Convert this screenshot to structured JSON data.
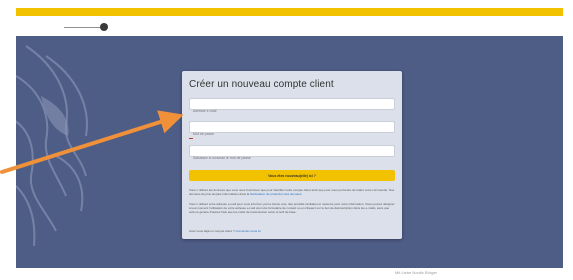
{
  "header": {
    "logo_icon": "logo-mark-icon"
  },
  "card": {
    "title": "Créer un nouveau compte client",
    "fields": [
      {
        "placeholder": "Adresse e-mail"
      },
      {
        "placeholder": "Mot de passe"
      },
      {
        "placeholder": "Saisissez à nouveau le mot de passe"
      }
    ],
    "submit_label": "Vous êtes nouveau(elle) ici ?",
    "paragraph1_text": "Vous n’utilisez les données que vous nous fournissez que pour identifier votre compte client ainsi que pour vous permettre de traiter votre commande. Nos données de plus amples informations dans la",
    "paragraph1_link": "Déclaration de protection des données.",
    "paragraph2_text": "Vous n’utilisez votre adresse e-mail pour vous informer, par la même voie, des produits similaires et mesures pour votre information. Vous pouvez désigner à tout moment l’utilisation de votre adresse e-mail via notre formulaire de contact ou en cliquant sur le lien de désinscription dans les e-mails, sans que cela ne génère d’autres frais que les coûts de transmission selon le tarif de base.",
    "login_prompt": "Avez-vous déjà un compte client ?",
    "login_link": "Connectez-vous ici"
  },
  "footer": {
    "text": "Mit Liebe Nordic Bürger"
  },
  "colors": {
    "accent": "#f2c200",
    "hero_bg": "#4e5d86",
    "card_bg": "#dbe0ea",
    "arrow": "#f0913a",
    "link": "#2c6fc0"
  }
}
